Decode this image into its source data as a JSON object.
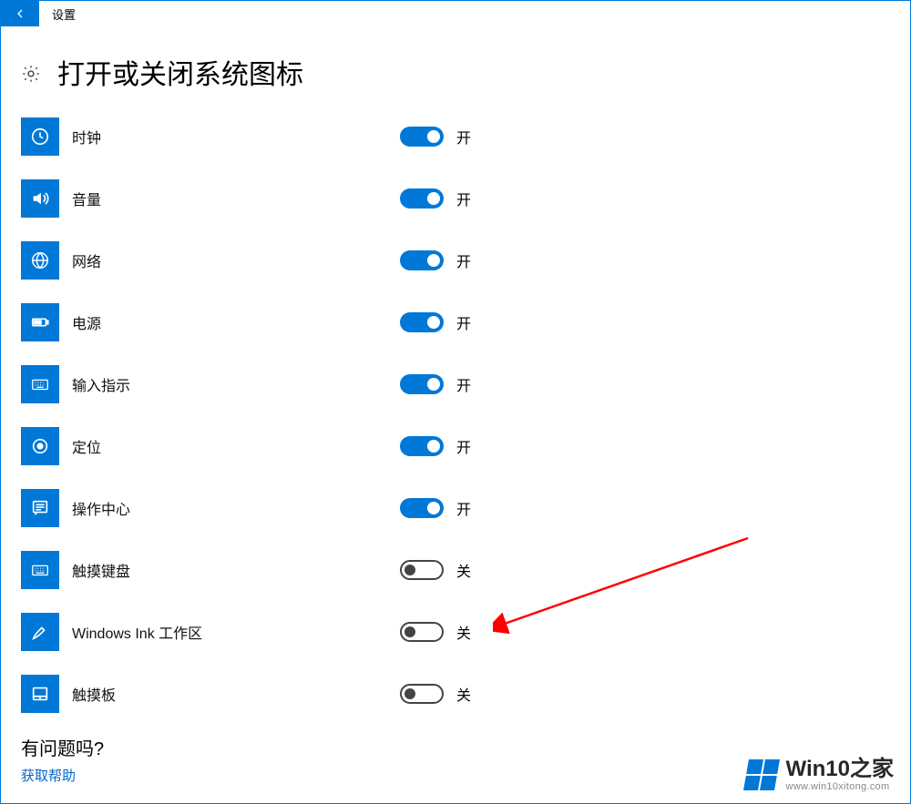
{
  "header": {
    "title": "设置"
  },
  "page": {
    "title": "打开或关闭系统图标"
  },
  "toggle_text": {
    "on": "开",
    "off": "关"
  },
  "items": [
    {
      "icon": "clock",
      "label": "时钟",
      "state": "on"
    },
    {
      "icon": "volume",
      "label": "音量",
      "state": "on"
    },
    {
      "icon": "network",
      "label": "网络",
      "state": "on"
    },
    {
      "icon": "power",
      "label": "电源",
      "state": "on"
    },
    {
      "icon": "ime",
      "label": "输入指示",
      "state": "on"
    },
    {
      "icon": "location",
      "label": "定位",
      "state": "on"
    },
    {
      "icon": "actioncenter",
      "label": "操作中心",
      "state": "on"
    },
    {
      "icon": "touchkb",
      "label": "触摸键盘",
      "state": "off"
    },
    {
      "icon": "ink",
      "label": "Windows Ink 工作区",
      "state": "off"
    },
    {
      "icon": "touchpad",
      "label": "触摸板",
      "state": "off"
    }
  ],
  "footer": {
    "question": "有问题吗?",
    "help_link": "获取帮助"
  },
  "watermark": {
    "text": "Win10之家",
    "url": "www.win10xitong.com"
  }
}
